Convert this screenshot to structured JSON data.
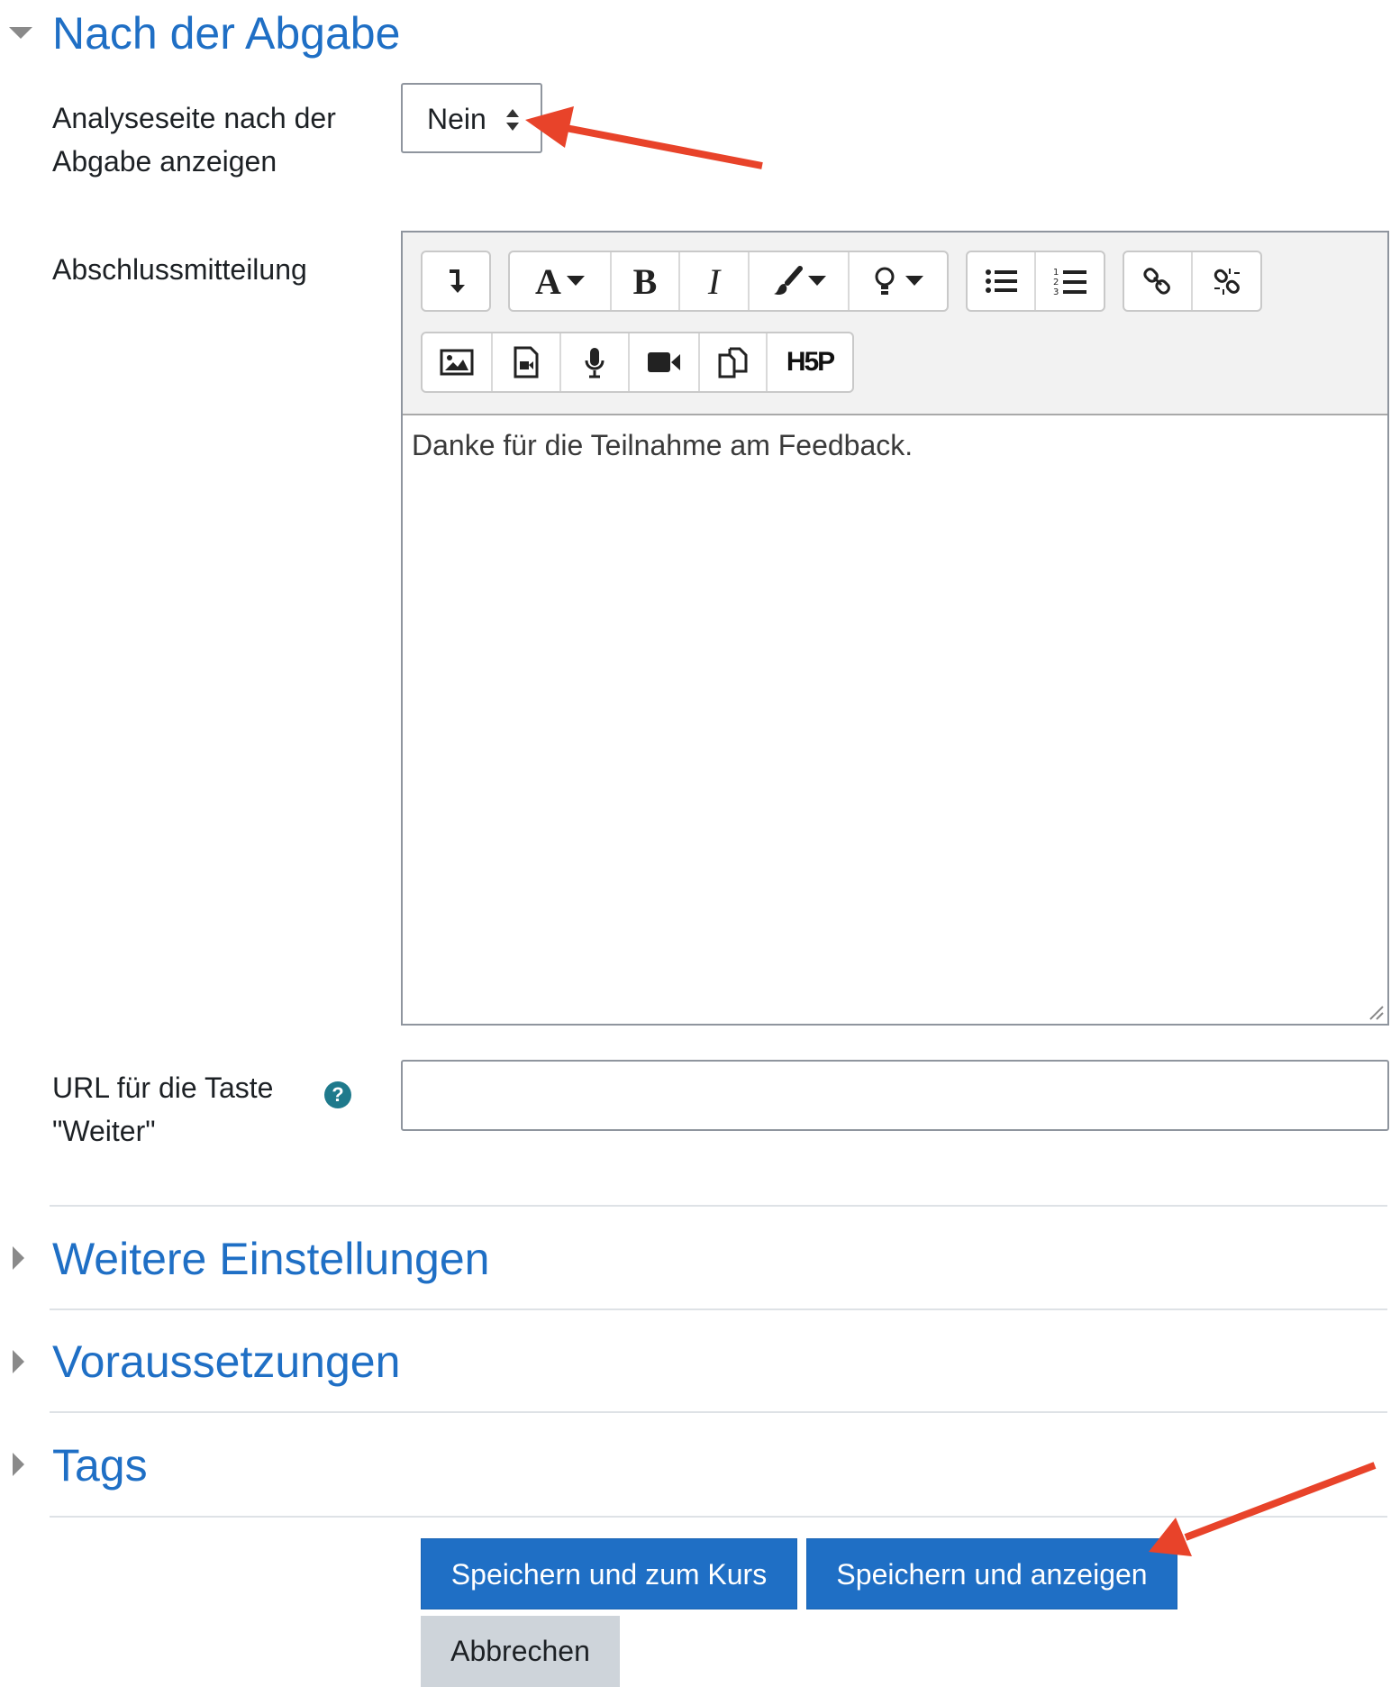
{
  "sections": {
    "after_submit": {
      "title": "Nach der Abgabe"
    },
    "more_settings": {
      "title": "Weitere Einstellungen"
    },
    "restrictions": {
      "title": "Voraussetzungen"
    },
    "tags": {
      "title": "Tags"
    }
  },
  "fields": {
    "analysis_page": {
      "label_line1": "Analyseseite nach der",
      "label_line2": "Abgabe anzeigen",
      "selected_value": "Nein"
    },
    "completion_message": {
      "label": "Abschlussmitteilung",
      "content": "Danke für die Teilnahme am Feedback."
    },
    "next_url": {
      "label_line1": "URL für die Taste",
      "label_line2": "\"Weiter\"",
      "value": "",
      "help_glyph": "?"
    }
  },
  "toolbar": {
    "font_glyph": "A",
    "bold_glyph": "B",
    "italic_glyph": "I",
    "h5p_label": "H5P",
    "icons": [
      "collapse-icon",
      "font-icon",
      "bold-icon",
      "italic-icon",
      "paintbrush-icon",
      "lightbulb-icon",
      "unordered-list-icon",
      "ordered-list-icon",
      "link-icon",
      "unlink-icon",
      "image-icon",
      "media-icon",
      "microphone-icon",
      "video-icon",
      "manage-files-icon",
      "h5p-icon"
    ]
  },
  "buttons": {
    "save_return": "Speichern und zum Kurs",
    "save_display": "Speichern und anzeigen",
    "cancel": "Abbrechen"
  },
  "colors": {
    "link_blue": "#1f6fc5",
    "annotation_red": "#e8432a",
    "secondary_gray": "#ced4da"
  }
}
